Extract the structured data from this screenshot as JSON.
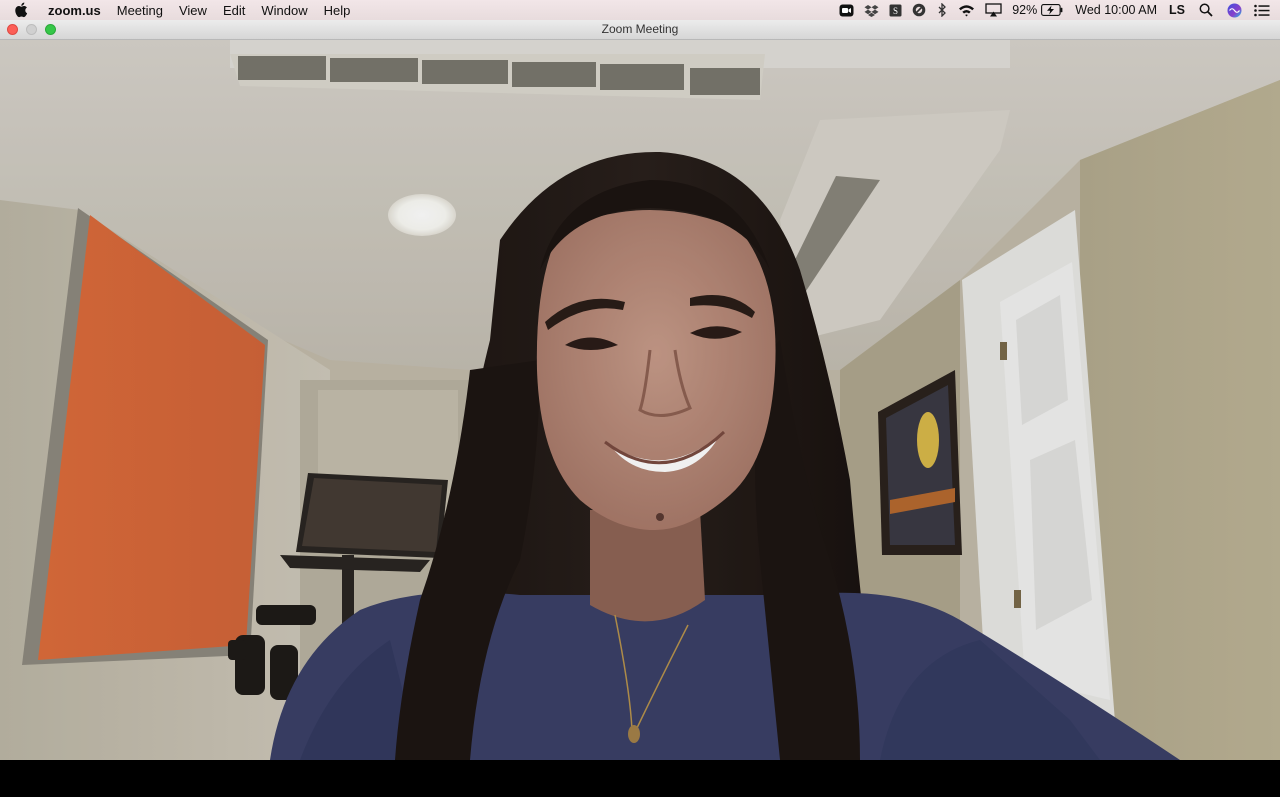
{
  "menubar": {
    "app": "zoom.us",
    "items": [
      "Meeting",
      "View",
      "Edit",
      "Window",
      "Help"
    ],
    "battery": "92%",
    "clock": "Wed 10:00 AM",
    "user": "LS",
    "status_icons": [
      "zoom-icon",
      "dropbox-icon",
      "scrivener-icon",
      "disk-icon",
      "bluetooth-icon",
      "wifi-icon",
      "airplay-icon",
      "battery-icon",
      "search-icon",
      "siri-icon",
      "notification-center-icon"
    ]
  },
  "window": {
    "title": "Zoom Meeting"
  },
  "colors": {
    "close": "#fc5f57",
    "minimize": "#d0d0d0",
    "zoom": "#35c748",
    "orange_canvas": "#d86a3a",
    "sweatshirt": "#3b4068"
  }
}
